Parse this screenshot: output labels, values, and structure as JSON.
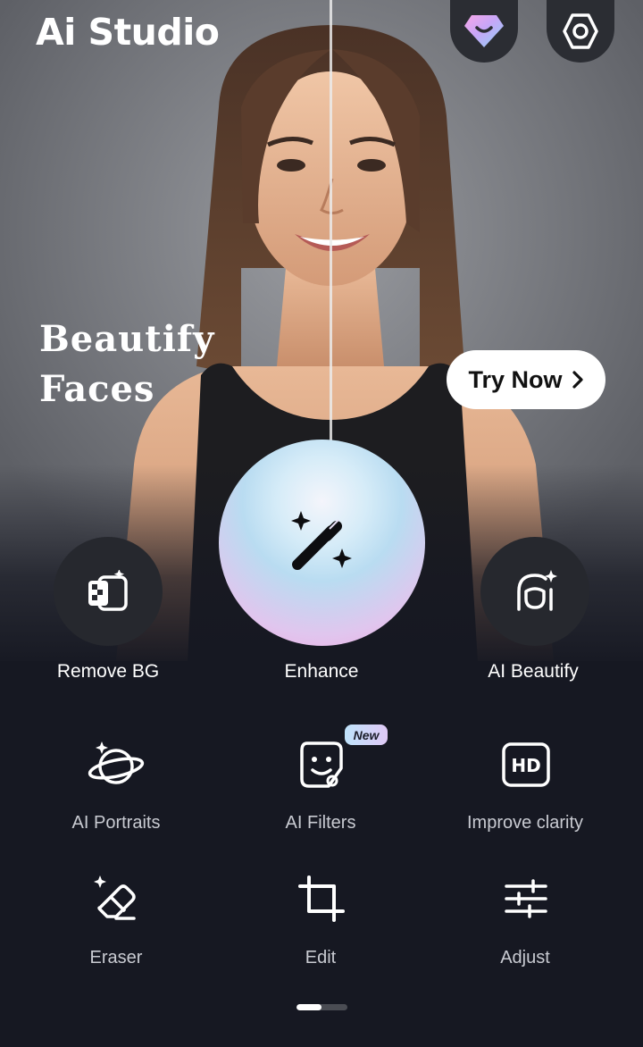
{
  "app": {
    "logo_text": "Ai Studio"
  },
  "header": {
    "premium_icon": "gem-icon",
    "settings_icon": "hexagon-gear-icon"
  },
  "hero": {
    "headline_line1": "Beautify",
    "headline_line2": "Faces",
    "try_label": "Try Now",
    "try_icon": "chevron-right-icon"
  },
  "main_tools": [
    {
      "label": "Remove BG",
      "icon": "remove-bg-icon"
    },
    {
      "label": "Enhance",
      "icon": "magic-wand-icon"
    },
    {
      "label": "AI Beautify",
      "icon": "face-sparkle-icon"
    }
  ],
  "grid_tools": [
    {
      "label": "AI Portraits",
      "icon": "planet-icon"
    },
    {
      "label": "AI Filters",
      "icon": "sticker-face-icon",
      "badge": "New"
    },
    {
      "label": "Improve clarity",
      "icon": "hd-icon"
    },
    {
      "label": "Eraser",
      "icon": "eraser-icon"
    },
    {
      "label": "Edit",
      "icon": "crop-icon"
    },
    {
      "label": "Adjust",
      "icon": "sliders-icon"
    }
  ],
  "pager": {
    "pages": 2,
    "active_page": 1
  },
  "colors": {
    "background": "#161822",
    "button_bg": "#26282e",
    "badge_gradient_start": "#bfe3fb",
    "badge_gradient_end": "#dfc9f6",
    "enhance_gradient_pink": "#f2a8e2",
    "enhance_gradient_blue": "#b9dcf1"
  }
}
